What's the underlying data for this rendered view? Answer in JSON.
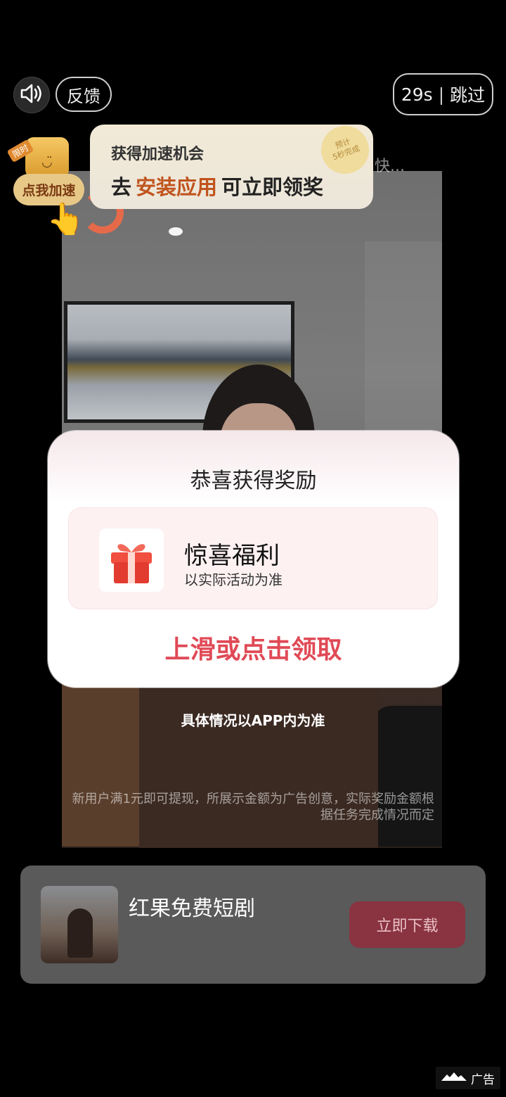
{
  "top": {
    "feedback_label": "反馈",
    "countdown": "29s",
    "skip_label": "跳过"
  },
  "speed": {
    "limited_tag": "限时",
    "button_label": "点我加速"
  },
  "banner": {
    "line1": "获得加速机会",
    "line2_prefix": "去",
    "line2_highlight": "安装应用",
    "line2_suffix": "可立即领奖",
    "estimate_line1": "预计",
    "estimate_line2": "5秒完成",
    "overflow_text": "快..."
  },
  "video": {
    "disclaimer": "新用户满1元即可提现，所展示金额为广告创意，实际奖励金额根据任务完成情况而定"
  },
  "reward": {
    "title": "恭喜获得奖励",
    "name": "惊喜福利",
    "subtitle": "以实际活动为准",
    "claim_label": "上滑或点击领取"
  },
  "note": "具体情况以APP内为准",
  "app": {
    "name": "红果免费短剧",
    "download_label": "立即下载"
  },
  "ad_label": "广告",
  "colors": {
    "accent_red": "#e04a56",
    "download_bg": "#8a3341",
    "highlight_orange": "#c0541e"
  }
}
